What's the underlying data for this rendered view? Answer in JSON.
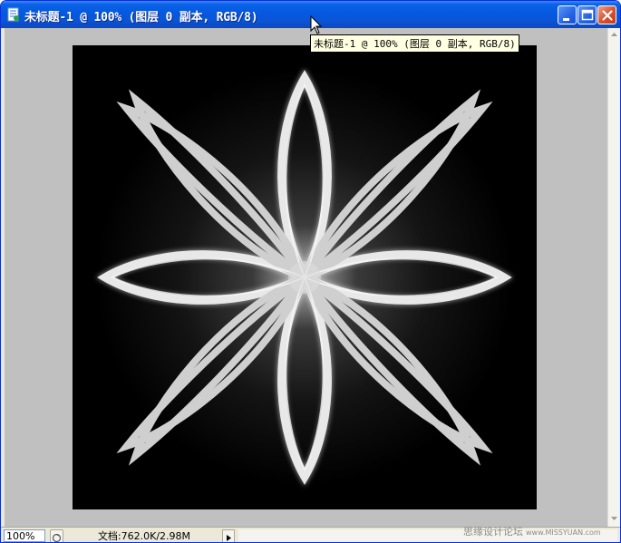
{
  "window": {
    "title": "未标题-1 @ 100% (图层 0 副本, RGB/8)",
    "tooltip": "未标题-1 @ 100% (图层 0 副本, RGB/8)"
  },
  "titlebar_buttons": {
    "minimize": "minimize-icon",
    "maximize": "maximize-icon",
    "close": "close-icon"
  },
  "canvas": {
    "background": "#000000",
    "artwork": "flower-star-icon"
  },
  "statusbar": {
    "zoom": "100%",
    "doc_info": "文档:762.0K/2.98M"
  },
  "watermark": {
    "text": "思缘设计论坛",
    "url": "www.MISSYUAN.com"
  },
  "colors": {
    "titlebar": "#0558e0",
    "workspace": "#c0c0c0",
    "close_button": "#d6512c"
  }
}
